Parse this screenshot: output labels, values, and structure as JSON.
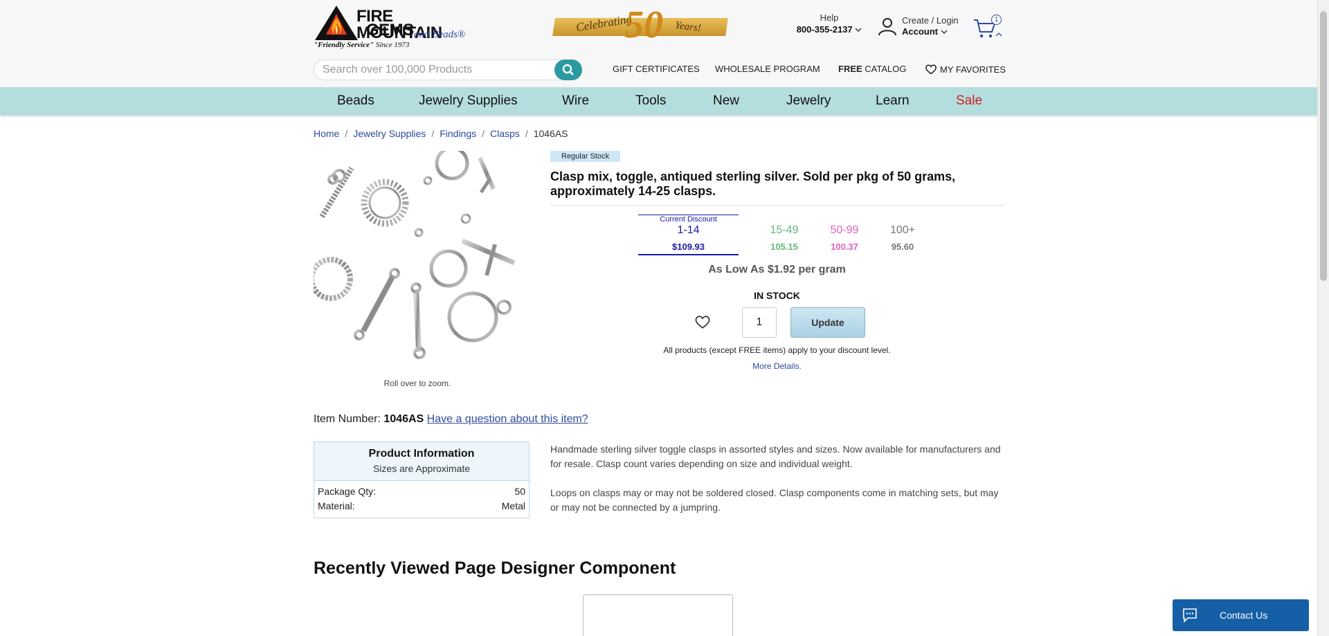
{
  "header": {
    "logo_line1": "FIRE MOUNTAIN",
    "logo_line2": "GEMS",
    "logo_beads": "and Beads®",
    "logo_tagline": "\"Friendly Service\"",
    "logo_since": "Since 1973",
    "anniversary_left": "Celebrating",
    "anniversary_number": "50",
    "anniversary_right": "Years!",
    "help_label": "Help",
    "help_phone": "800-355-2137",
    "account_line1": "Create / Login",
    "account_line2": "Account",
    "cart_count": "1"
  },
  "search": {
    "placeholder": "Search over 100,000 Products"
  },
  "toplinks": {
    "gift": "GIFT CERTIFICATES",
    "wholesale": "WHOLESALE PROGRAM",
    "catalog_bold": "FREE",
    "catalog": "CATALOG",
    "favorites": "MY FAVORITES"
  },
  "nav": [
    "Beads",
    "Jewelry Supplies",
    "Wire",
    "Tools",
    "New",
    "Jewelry",
    "Learn",
    "Sale"
  ],
  "breadcrumb": [
    "Home",
    "Jewelry Supplies",
    "Findings",
    "Clasps",
    "1046AS"
  ],
  "product": {
    "stock_badge": "Regular Stock",
    "title": "Clasp mix, toggle, antiqued sterling silver. Sold per pkg of 50 grams, approximately 14-25 clasps.",
    "rollover": "Roll over to zoom.",
    "current_discount_label": "Current Discount",
    "tiers": [
      {
        "qty": "1-14",
        "price": "$109.93",
        "color": "#1a1aa6"
      },
      {
        "qty": "15-49",
        "price": "105.15",
        "color": "#63b87a"
      },
      {
        "qty": "50-99",
        "price": "100.37",
        "color": "#e060c0"
      },
      {
        "qty": "100+",
        "price": "95.60",
        "color": "#777777"
      }
    ],
    "as_low_as": "As Low As $1.92 per gram",
    "stock_status": "IN STOCK",
    "quantity": "1",
    "update_label": "Update",
    "discount_note": "All products (except FREE items) apply to your discount level.",
    "more_details": "More Details.",
    "item_number_label": "Item Number:",
    "item_number": "1046AS",
    "question_link": "Have a question about this item?"
  },
  "product_info": {
    "title": "Product Information",
    "subtitle": "Sizes are Approximate",
    "rows": [
      {
        "key": "Package Qty:",
        "value": "50"
      },
      {
        "key": "Material:",
        "value": "Metal"
      }
    ]
  },
  "description": [
    "Handmade sterling silver toggle clasps in assorted styles and sizes. Now available for manufacturers and for resale. Clasp count varies depending on size and individual weight.",
    "Loops on clasps may or may not be soldered closed. Clasp components come in matching sets, but may or may not be connected by a jumpring."
  ],
  "recently_viewed": {
    "title": "Recently Viewed Page Designer Component"
  },
  "contact": {
    "label": "Contact Us"
  },
  "icons": {
    "search": "search-icon",
    "account": "user-icon",
    "cart": "cart-icon",
    "favorites": "heart-icon",
    "chat": "chat-icon"
  },
  "colors": {
    "teal_nav": "#b4dedd",
    "search_button": "#2a9aa0",
    "link": "#2d4b9c",
    "sale": "#d0202e",
    "contact_bg": "#155fa6"
  }
}
